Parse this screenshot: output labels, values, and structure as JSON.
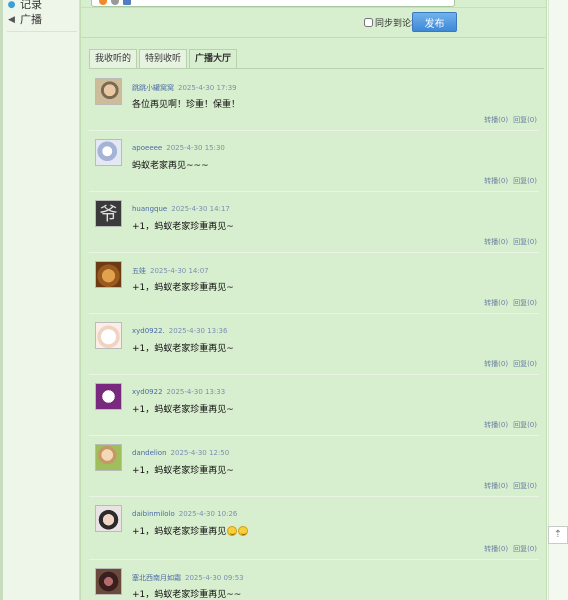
{
  "sidebar": {
    "items": [
      {
        "label": "记录",
        "icon": "bubble-icon"
      },
      {
        "label": "广播",
        "icon": "speaker-icon"
      }
    ]
  },
  "composer": {
    "sync_label": "同步到论坛",
    "publish_label": "发布"
  },
  "tabs": [
    {
      "label": "我收听的",
      "active": false
    },
    {
      "label": "特别收听",
      "active": false
    },
    {
      "label": "广播大厅",
      "active": true
    }
  ],
  "posts": [
    {
      "user": "跳跳小罐窝窝",
      "time": "2025-4-30 17:39",
      "text": "各位再见啊！珍重！保重！",
      "forward": "转播(0)",
      "reply": "回复(0)",
      "emoji": ""
    },
    {
      "user": "apoeeee",
      "time": "2025-4-30 15:30",
      "text": "蚂蚁老家再见~~~",
      "forward": "转播(0)",
      "reply": "回复(0)",
      "emoji": ""
    },
    {
      "user": "huangque",
      "time": "2025-4-30 14:17",
      "text": "+1，蚂蚁老家珍重再见~",
      "forward": "转播(0)",
      "reply": "回复(0)",
      "emoji": ""
    },
    {
      "user": "五娃",
      "time": "2025-4-30 14:07",
      "text": "+1，蚂蚁老家珍重再见~",
      "forward": "转播(0)",
      "reply": "回复(0)",
      "emoji": ""
    },
    {
      "user": "xyd0922.",
      "time": "2025-4-30 13:36",
      "text": "+1，蚂蚁老家珍重再见~",
      "forward": "转播(0)",
      "reply": "回复(0)",
      "emoji": ""
    },
    {
      "user": "xyd0922",
      "time": "2025-4-30 13:33",
      "text": "+1，蚂蚁老家珍重再见~",
      "forward": "转播(0)",
      "reply": "回复(0)",
      "emoji": ""
    },
    {
      "user": "dandelion",
      "time": "2025-4-30 12:50",
      "text": "+1，蚂蚁老家珍重再见~",
      "forward": "转播(0)",
      "reply": "回复(0)",
      "emoji": ""
    },
    {
      "user": "daibinmilolo",
      "time": "2025-4-30 10:26",
      "text": "+1，蚂蚁老家珍重再见",
      "forward": "转播(0)",
      "reply": "回复(0)",
      "emoji": "laughing-emoji"
    },
    {
      "user": "塞北西南月如霜",
      "time": "2025-4-30 09:53",
      "text": "+1，蚂蚁老家珍重再见~~",
      "forward": "",
      "reply": "",
      "emoji": ""
    }
  ],
  "colors": {
    "panel_bg": "#d8efcf",
    "sidebar_bg": "#eef6ea",
    "publish_btn": "#3f88d6",
    "username": "#4a6aa5"
  }
}
